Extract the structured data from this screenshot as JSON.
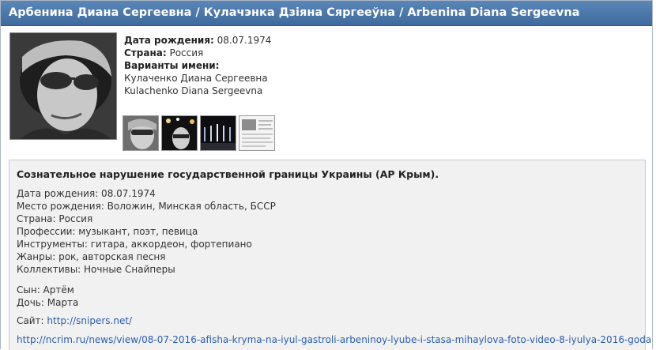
{
  "title": "Арбенина Диана Сергеевна / Кулачэнка Дзіяна Сяргееўна / Arbenina Diana Sergeevna",
  "profile": {
    "birth_label": "Дата рождения:",
    "birth_value": "08.07.1974",
    "country_label": "Страна:",
    "country_value": "Россия",
    "variants_label": "Варианты имени:",
    "variants": [
      "Кулаченко Диана Сергеевна",
      "Kulachenko Diana Sergeevna"
    ]
  },
  "panel": {
    "heading": "Сознательное нарушение государственной границы Украины (АР Крым).",
    "lines": [
      "Дата рождения: 08.07.1974",
      "Место рождения: Воложин, Минская область, БССР",
      "Страна: Россия",
      "Профессии: музыкант, поэт, певица",
      "Инструменты: гитара, аккордеон, фортепиано",
      "Жанры: рок, авторская песня",
      "Коллективы: Ночные Снайперы"
    ],
    "kids": [
      "Сын: Артём",
      "Дочь: Марта"
    ],
    "site_label": "Сайт:",
    "site_url": "http://snipers.net/",
    "news_url": "http://ncrim.ru/news/view/08-07-2016-afisha-kryma-na-iyul-gastroli-arbeninoy-lyube-i-stasa-mihaylova-foto-video-8-iyulya-2016-goda"
  }
}
